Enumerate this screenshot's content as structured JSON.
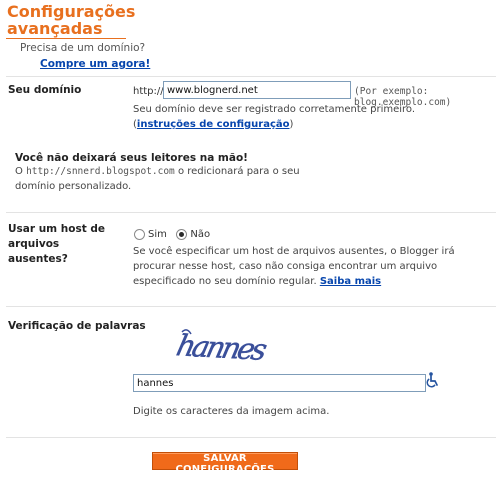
{
  "page": {
    "title": "Configurações avançadas",
    "need_domain_text": "Precisa de um domínio?",
    "buy_link": "Compre um agora!"
  },
  "domain": {
    "label": "Seu domínio",
    "prefix": "http://",
    "value": "www.blognerd.net",
    "example": "(Por exemplo: blog.exemplo.com)",
    "help_text": "Seu domínio deve ser registrado corretamente primeiro. (",
    "help_link": "instruções de configuração",
    "help_close": ")",
    "notice_title": "Você não deixará seus leitores na mão!",
    "notice_prefix": "O ",
    "notice_url": "http://snnerd.blogspot.com",
    "notice_suffix": " o redicionará para o seu domínio personalizado."
  },
  "host": {
    "label": "Usar um host de arquivos ausentes?",
    "option_yes": "Sim",
    "option_no": "Não",
    "selected": "Não",
    "help_text": "Se você especificar um host de arquivos ausentes, o Blogger irá procurar nesse host, caso não consiga encontrar um arquivo especificado no seu domínio regular. ",
    "help_link": "Saiba mais"
  },
  "verification": {
    "label": "Verificação de palavras",
    "captcha_word": "hannes",
    "input_value": "hannes",
    "instruction": "Digite os caracteres da imagem acima."
  },
  "actions": {
    "save_label": "SALVAR CONFIGURAÇÕES"
  },
  "colors": {
    "accent": "#e8701f",
    "button": "#f06a1a",
    "link": "#0645ad",
    "captcha_ink": "#3a4f9a"
  },
  "icons": {
    "accessibility": "wheelchair-icon"
  }
}
